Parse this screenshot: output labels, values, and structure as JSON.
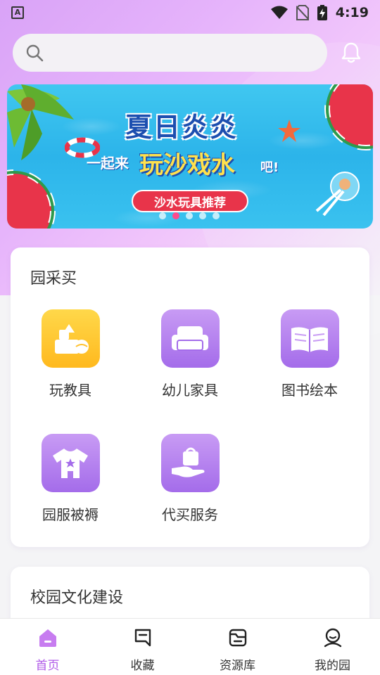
{
  "status_bar": {
    "app_icon_letter": "A",
    "time": "4:19"
  },
  "search": {
    "placeholder": "",
    "value": ""
  },
  "banner": {
    "title_line1": "夏日炎炎",
    "prefix": "一起来",
    "headline": "玩沙戏水",
    "suffix": "吧!",
    "button_label": "沙水玩具推荐",
    "slide_count": 5,
    "active_slide": 1
  },
  "purchase_section": {
    "title": "园采买",
    "items": [
      {
        "label": "玩教具",
        "icon": "toy-blocks-icon",
        "color": "yellow"
      },
      {
        "label": "幼儿家具",
        "icon": "sofa-icon",
        "color": "purple"
      },
      {
        "label": "图书绘本",
        "icon": "open-book-icon",
        "color": "purple"
      },
      {
        "label": "园服被褥",
        "icon": "baby-clothes-icon",
        "color": "purple"
      },
      {
        "label": "代买服务",
        "icon": "shopping-bag-hand-icon",
        "color": "purple"
      }
    ]
  },
  "culture_section": {
    "title": "校园文化建设"
  },
  "tabbar": {
    "tabs": [
      {
        "label": "首页",
        "icon": "home-icon",
        "active": true
      },
      {
        "label": "收藏",
        "icon": "favorites-icon",
        "active": false
      },
      {
        "label": "资源库",
        "icon": "folder-icon",
        "active": false
      },
      {
        "label": "我的园",
        "icon": "profile-icon",
        "active": false
      }
    ]
  },
  "colors": {
    "accent": "#b05ae8",
    "icon_purple": "#a46cea",
    "icon_yellow": "#ffc12e",
    "banner_sky": "#2cb4ea",
    "banner_button": "#e8344a"
  }
}
